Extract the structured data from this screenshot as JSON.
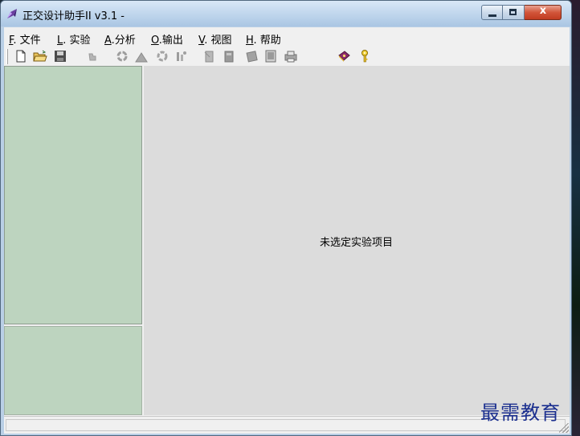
{
  "window": {
    "title": "正交设计助手II v3.1 -",
    "close_glyph": "x"
  },
  "menu": {
    "items": [
      {
        "accel": "F",
        "rest": ". 文件"
      },
      {
        "accel": "L",
        "rest": ". 实验"
      },
      {
        "accel": "A",
        "rest": ".分析"
      },
      {
        "accel": "O",
        "rest": ".输出"
      },
      {
        "accel": "V",
        "rest": ". 视图"
      },
      {
        "accel": "H",
        "rest": ". 帮助"
      }
    ]
  },
  "toolbar": {
    "icons": [
      "new-file-icon",
      "open-folder-icon",
      "save-disk-icon",
      "disabled-tool-icon",
      "recycle-icon",
      "warning-triangle-icon",
      "recycle-gear-icon",
      "chart-icon",
      "document-edit-icon",
      "page-icon",
      "export-icon",
      "preview-icon",
      "print-icon",
      "help-book-icon",
      "about-key-icon"
    ]
  },
  "main": {
    "message": "未选定实验项目"
  },
  "watermark": {
    "text": "最需教育"
  },
  "colors": {
    "panel_green": "#bdd4bf",
    "main_gray": "#dcdcdc",
    "chrome": "#f0f0f0"
  }
}
